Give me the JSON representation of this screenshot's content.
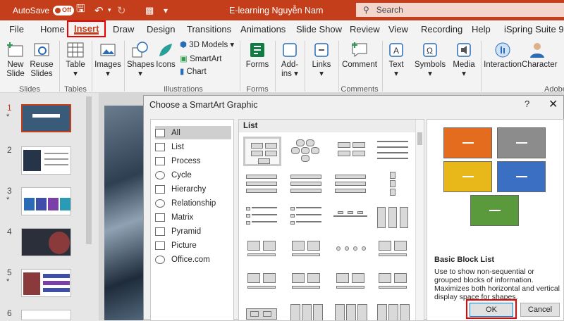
{
  "titlebar": {
    "autosave_label": "AutoSave",
    "autosave_state": "Off",
    "doc_title": "E-learning Nguyễn Nam",
    "search_placeholder": "Search"
  },
  "tabs": [
    "File",
    "Home",
    "Insert",
    "Draw",
    "Design",
    "Transitions",
    "Animations",
    "Slide Show",
    "Review",
    "View",
    "Recording",
    "Help",
    "iSpring Suite 9"
  ],
  "ribbon": {
    "new_slide": "New\nSlide",
    "reuse_slides": "Reuse\nSlides",
    "table": "Table",
    "images": "Images",
    "shapes": "Shapes",
    "icons": "Icons",
    "models_3d": "3D Models",
    "smartart": "SmartArt",
    "chart": "Chart",
    "forms": "Forms",
    "addins": "Add-\nins",
    "links": "Links",
    "comment": "Comment",
    "text": "Text",
    "symbols": "Symbols",
    "media": "Media",
    "interaction": "Interaction",
    "character": "Character",
    "groups": {
      "slides": "Slides",
      "tables": "Tables",
      "illustrations": "Illustrations",
      "forms": "Forms",
      "comments": "Comments",
      "adobe": "Adobe"
    }
  },
  "slides": {
    "numbers": [
      "1",
      "2",
      "3",
      "4",
      "5",
      "6"
    ],
    "starred": [
      "1",
      "3",
      "5"
    ]
  },
  "dialog": {
    "title": "Choose a SmartArt Graphic",
    "help": "?",
    "close": "✕",
    "categories": [
      "All",
      "List",
      "Process",
      "Cycle",
      "Hierarchy",
      "Relationship",
      "Matrix",
      "Pyramid",
      "Picture",
      "Office.com"
    ],
    "selected_category": "All",
    "gallery_header": "List",
    "preview_name": "Basic Block List",
    "preview_desc": "Use to show non-sequential or grouped blocks of information. Maximizes both horizontal and vertical display space for shapes.",
    "ok": "OK",
    "cancel": "Cancel",
    "preview_colors": [
      "#e36c1f",
      "#8c8c8c",
      "#e8b71a",
      "#3a6fc4",
      "#5a9a3c"
    ]
  },
  "colors": {
    "accent": "#c43e1c",
    "highlight": "#ee0000"
  }
}
